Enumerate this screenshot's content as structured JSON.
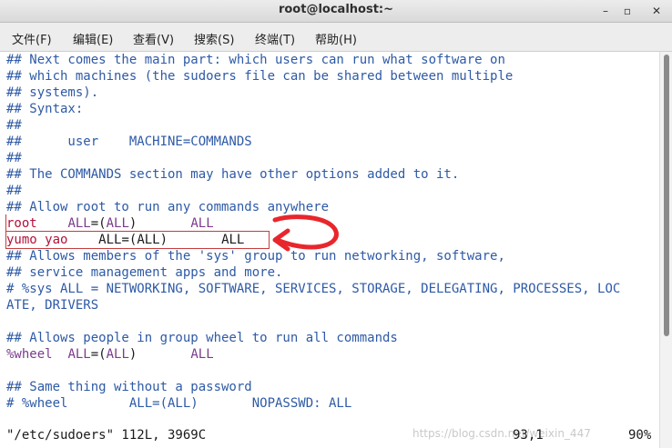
{
  "window": {
    "title": "root@localhost:~",
    "minimize_glyph": "–",
    "maximize_glyph": "▫",
    "close_glyph": "✕"
  },
  "menu": [
    "文件(F)",
    "编辑(E)",
    "查看(V)",
    "搜索(S)",
    "终端(T)",
    "帮助(H)"
  ],
  "lines": [
    "## Next comes the main part: which users can run what software on",
    "## which machines (the sudoers file can be shared between multiple",
    "## systems).",
    "## Syntax:",
    "##",
    "##      user    MACHINE=COMMANDS",
    "##",
    "## The COMMANDS section may have other options added to it.",
    "##",
    "## Allow root to run any commands anywhere",
    "",
    "",
    "## Allows members of the 'sys' group to run networking, software,",
    "## service management apps and more.",
    "# %sys ALL = NETWORKING, SOFTWARE, SERVICES, STORAGE, DELEGATING, PROCESSES, LOC",
    "ATE, DRIVERS",
    "",
    "## Allows people in group wheel to run all commands",
    "",
    "",
    "## Same thing without a password",
    "# %wheel        ALL=(ALL)       NOPASSWD: ALL"
  ],
  "rules": {
    "root": {
      "user": "root",
      "gap1": "    ",
      "all1": "ALL",
      "eq": "=(",
      "all2": "ALL",
      "close": ")",
      "gap2": "       ",
      "all3": "ALL"
    },
    "yumo": {
      "user": "yumo yao",
      "gap1": "    ",
      "all1": "ALL",
      "eq": "=(",
      "all2": "ALL",
      "close": ")",
      "gap2": "       ",
      "all3": "ALL"
    },
    "wheel": {
      "user": "%wheel",
      "gap1": "  ",
      "all1": "ALL",
      "eq": "=(",
      "all2": "ALL",
      "close": ")",
      "gap2": "       ",
      "all3": "ALL"
    }
  },
  "status": {
    "file_info": "\"/etc/sudoers\" 112L, 3969C",
    "cursor_pos": "93,1",
    "scroll_percent": "90%"
  },
  "watermark": "https://blog.csdn.net/weixin_447"
}
